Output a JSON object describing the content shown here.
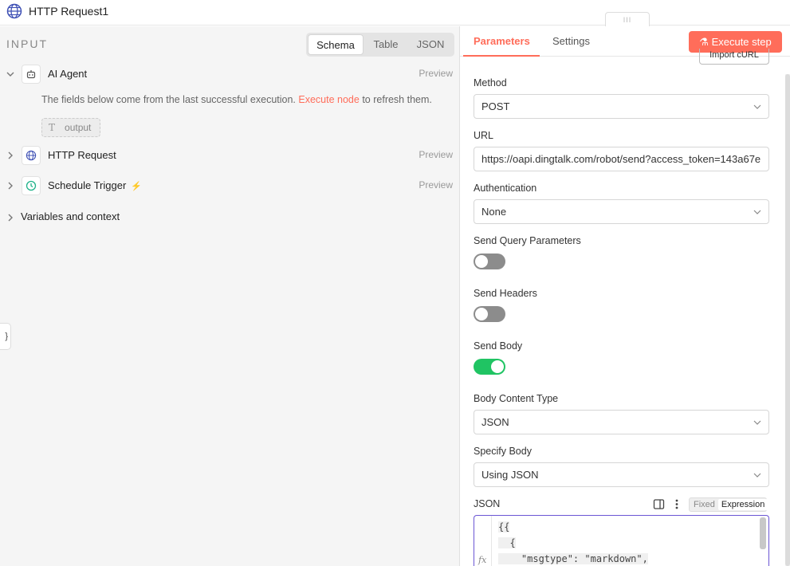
{
  "header": {
    "title": "HTTP Request1",
    "drag_glyph": "III"
  },
  "input_panel": {
    "label": "INPUT",
    "views": [
      "Schema",
      "Table",
      "JSON"
    ],
    "nodes": [
      {
        "name": "AI Agent",
        "preview": "Preview",
        "icon": "robot-icon"
      },
      {
        "name": "HTTP Request",
        "preview": "Preview",
        "icon": "globe-icon"
      },
      {
        "name": "Schedule Trigger",
        "preview": "Preview",
        "icon": "clock-icon"
      }
    ],
    "info_prefix": "The fields below come from the last successful execution.",
    "info_link": "Execute node",
    "info_suffix": "to refresh them.",
    "output_field": "output",
    "output_type_glyph": "T",
    "context_label": "Variables and context",
    "side_tab_glyph": "}"
  },
  "parameters": {
    "tabs": [
      "Parameters",
      "Settings"
    ],
    "execute_label": "Execute step",
    "import_label": "Import cURL",
    "method_label": "Method",
    "method_value": "POST",
    "url_label": "URL",
    "url_value": "https://oapi.dingtalk.com/robot/send?access_token=143a67e",
    "auth_label": "Authentication",
    "auth_value": "None",
    "query_label": "Send Query Parameters",
    "query_on": false,
    "headers_label": "Send Headers",
    "headers_on": false,
    "body_label": "Send Body",
    "body_on": true,
    "content_type_label": "Body Content Type",
    "content_type_value": "JSON",
    "specify_label": "Specify Body",
    "specify_value": "Using JSON",
    "json_label": "JSON",
    "mode_fixed": "Fixed",
    "mode_expression": "Expression",
    "fx": "fx",
    "code_lines": [
      "{{",
      "  {",
      "    \"msgtype\": \"markdown\","
    ]
  },
  "colors": {
    "accent": "#ff6d5a",
    "toggle_on": "#20c463",
    "editor_border": "#6b56d4"
  }
}
